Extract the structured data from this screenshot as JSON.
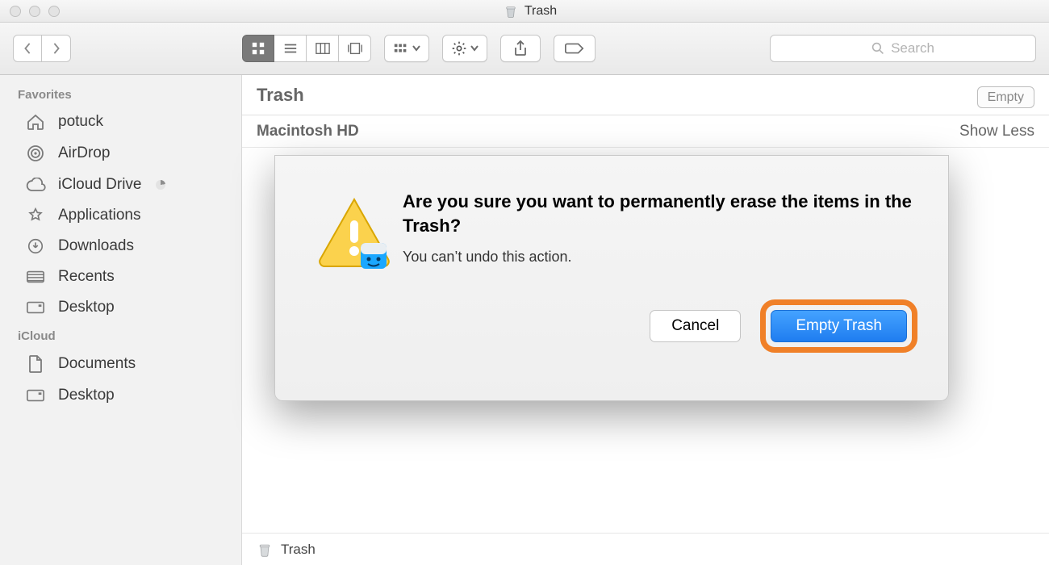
{
  "titlebar": {
    "title": "Trash"
  },
  "toolbar": {
    "search_placeholder": "Search"
  },
  "sidebar": {
    "sections": [
      {
        "title": "Favorites",
        "items": [
          {
            "label": "potuck",
            "icon": "home-icon",
            "badge": false
          },
          {
            "label": "AirDrop",
            "icon": "airdrop-icon",
            "badge": false
          },
          {
            "label": "iCloud Drive",
            "icon": "cloud-icon",
            "badge": true
          },
          {
            "label": "Applications",
            "icon": "applications-icon",
            "badge": false
          },
          {
            "label": "Downloads",
            "icon": "downloads-icon",
            "badge": false
          },
          {
            "label": "Recents",
            "icon": "recents-icon",
            "badge": false
          },
          {
            "label": "Desktop",
            "icon": "desktop-icon",
            "badge": false
          }
        ]
      },
      {
        "title": "iCloud",
        "items": [
          {
            "label": "Documents",
            "icon": "documents-icon",
            "badge": false
          },
          {
            "label": "Desktop",
            "icon": "desktop-icon",
            "badge": false
          }
        ]
      }
    ]
  },
  "main": {
    "location_title": "Trash",
    "empty_button": "Empty",
    "group_title": "Macintosh HD",
    "group_toggle": "Show Less",
    "footer_label": "Trash"
  },
  "dialog": {
    "heading": "Are you sure you want to permanently erase the items in the Trash?",
    "body": "You can’t undo this action.",
    "cancel": "Cancel",
    "confirm": "Empty Trash"
  }
}
